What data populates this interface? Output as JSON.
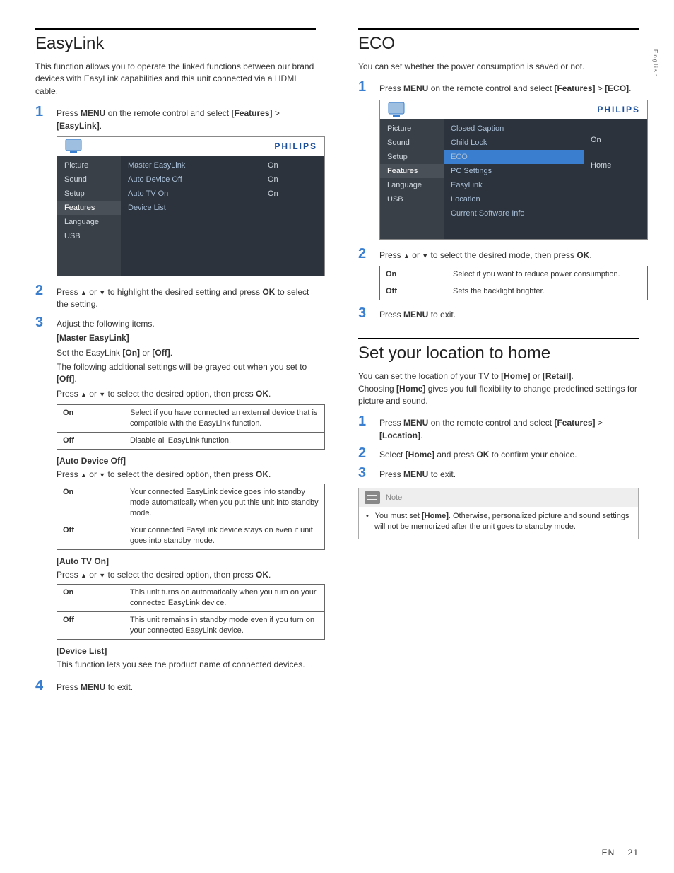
{
  "sideTab": "English",
  "footer": {
    "lang": "EN",
    "page": "21"
  },
  "left": {
    "title": "EasyLink",
    "intro": "This function allows you to operate the linked functions between our brand devices with EasyLink capabilities and this unit connected via a HDMI cable.",
    "step1": {
      "pre": "Press ",
      "b1": "MENU",
      "mid": " on the remote control and select ",
      "b2": "[Features]",
      "sep": " > ",
      "b3": "[EasyLink]",
      "end": "."
    },
    "osd": {
      "brand": "PHILIPS",
      "col1": [
        "Picture",
        "Sound",
        "Setup",
        "Features",
        "Language",
        "USB"
      ],
      "col1Selected": 3,
      "rows": [
        {
          "label": "Master EasyLink",
          "value": "On"
        },
        {
          "label": "Auto Device Off",
          "value": "On"
        },
        {
          "label": "Auto TV On",
          "value": "On"
        },
        {
          "label": "Device List",
          "value": ""
        }
      ]
    },
    "step2": {
      "pre": "Press ",
      "mid": " or ",
      "post": " to highlight the desired setting and press ",
      "b1": "OK",
      "end": " to select the setting."
    },
    "step3": {
      "line1": "Adjust the following items.",
      "masterHdr": "[Master EasyLink]",
      "masterSet": {
        "pre": "Set the EasyLink ",
        "b1": "[On]",
        "or": " or ",
        "b2": "[Off]",
        "end": "."
      },
      "masterGrey": {
        "pre": "The following additional settings will be grayed out when you set to ",
        "b1": "[Off]",
        "end": "."
      },
      "selectLine": {
        "pre": "Press ",
        "mid": " or ",
        "post": " to select the desired option, then press ",
        "b1": "OK",
        "end": "."
      },
      "tableA": {
        "on": "Select if you have connected an external device that is compatible with the EasyLink function.",
        "off": "Disable all EasyLink function."
      },
      "autoDevHdr": "[Auto Device Off]",
      "tableB": {
        "on": "Your connected EasyLink device goes into standby mode automatically when you put this unit into standby mode.",
        "off": "Your connected EasyLink device stays on even if unit goes into standby mode."
      },
      "autoTvHdr": "[Auto TV On]",
      "tableC": {
        "on": "This unit turns on automatically when you turn on your connected EasyLink device.",
        "off": "This unit remains in standby mode even if you turn on your connected EasyLink device."
      },
      "devListHdr": "[Device List]",
      "devListTxt": "This function lets you see the product name of connected devices."
    },
    "step4": {
      "pre": "Press ",
      "b1": "MENU",
      "end": " to exit."
    },
    "labels": {
      "on": "On",
      "off": "Off"
    }
  },
  "right": {
    "eco": {
      "title": "ECO",
      "intro": "You can set whether the power consumption is saved or not.",
      "step1": {
        "pre": "Press ",
        "b1": "MENU",
        "mid": " on the remote control and select ",
        "b2": "[Features]",
        "sep": " > ",
        "b3": "[ECO]",
        "end": "."
      },
      "osd": {
        "brand": "PHILIPS",
        "col1": [
          "Picture",
          "Sound",
          "Setup",
          "Features",
          "Language",
          "USB"
        ],
        "col1Selected": 3,
        "rows": [
          {
            "label": "Closed Caption",
            "value": ""
          },
          {
            "label": "Child Lock",
            "value": ""
          },
          {
            "label": "ECO",
            "value": "On",
            "hl": true
          },
          {
            "label": "PC Settings",
            "value": ""
          },
          {
            "label": "EasyLink",
            "value": ""
          },
          {
            "label": "Location",
            "value": "Home"
          },
          {
            "label": "Current Software Info",
            "value": ""
          }
        ]
      },
      "step2": {
        "pre": "Press ",
        "mid": " or ",
        "post": " to select the desired mode, then press ",
        "b1": "OK",
        "end": "."
      },
      "table": {
        "on": "Select if you want to reduce power consumption.",
        "off": "Sets the backlight brighter."
      },
      "step3": {
        "pre": "Press ",
        "b1": "MENU",
        "end": " to exit."
      }
    },
    "loc": {
      "title": "Set your location to home",
      "intro": {
        "p1a": "You can set the location of your TV to ",
        "b1": "[Home]",
        "or": " or ",
        "b2": "[Retail]",
        "p1b": ".",
        "p2a": "Choosing ",
        "b3": "[Home]",
        "p2b": " gives you full flexibility to change predefined settings for picture and sound."
      },
      "step1": {
        "pre": "Press ",
        "b1": "MENU",
        "mid": " on the remote control and select ",
        "b2": "[Features]",
        "sep": " > ",
        "b3": "[Location]",
        "end": "."
      },
      "step2": {
        "pre": "Select ",
        "b1": "[Home]",
        "mid": " and press ",
        "b2": "OK",
        "end": " to confirm your choice."
      },
      "step3": {
        "pre": "Press ",
        "b1": "MENU",
        "end": " to exit."
      },
      "note": {
        "label": "Note",
        "pre": "You must set ",
        "b1": "[Home]",
        "post": ". Otherwise, personalized picture and sound settings will not be memorized after the unit goes to standby mode."
      }
    },
    "labels": {
      "on": "On",
      "off": "Off"
    }
  }
}
